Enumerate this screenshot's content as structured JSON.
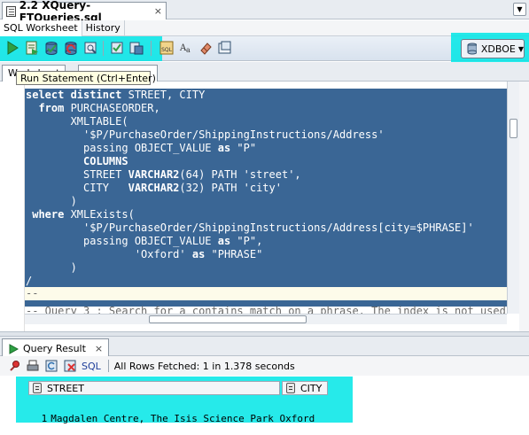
{
  "document_tab": {
    "title": "2.2 XQuery-FTQueries.sql",
    "close_glyph": "×",
    "menu_glyph": "▼"
  },
  "sub_tabs": [
    "SQL Worksheet",
    "History"
  ],
  "toolbar": {
    "icons": [
      "run-statement-icon",
      "run-script-icon",
      "commit-icon",
      "rollback-icon",
      "autotrace-icon",
      "explain-plan-icon",
      "sql-tuning-icon",
      "clear-icon",
      "sql-history-icon",
      "format-case-icon",
      "eraser-icon",
      "find-icon"
    ],
    "connection": "XDBOE",
    "highlight_color": "#00e6e6"
  },
  "tooltip": {
    "text": "Run Statement (Ctrl+Enter)"
  },
  "worksheet_tab_label": "Worksheet",
  "editor": {
    "lines": [
      [
        "select distinct",
        " STREET, CITY"
      ],
      [
        "  from",
        " PURCHASEORDER,"
      ],
      [
        "",
        "       XMLTABLE("
      ],
      [
        "",
        "         '$P/PurchaseOrder/ShippingInstructions/Address'"
      ],
      [
        "",
        "         passing OBJECT_VALUE ",
        "as",
        " \"P\""
      ],
      [
        "",
        "         ",
        "COLUMNS"
      ],
      [
        "",
        "         STREET ",
        "VARCHAR2",
        "(64) PATH 'street',"
      ],
      [
        "",
        "         CITY   ",
        "VARCHAR2",
        "(32) PATH 'city'"
      ],
      [
        "",
        "       )"
      ],
      [
        " where",
        " XMLExists("
      ],
      [
        "",
        "         '$P/PurchaseOrder/ShippingInstructions/Address[city=$PHRASE]'"
      ],
      [
        "",
        "         passing OBJECT_VALUE ",
        "as",
        " \"P\","
      ],
      [
        "",
        "                 'Oxford' ",
        "as",
        " \"PHRASE\""
      ],
      [
        "",
        "       )"
      ],
      [
        "",
        "/"
      ]
    ],
    "caret_line": "--",
    "comment_line": "-- Query 3 : Search for a contains match on a phrase. The index is not used",
    "selection_color": "#3a6695"
  },
  "query_result": {
    "tab_label": "Query Result",
    "close_glyph": "×",
    "sql_link": "SQL",
    "status": "All Rows Fetched: 1 in 1.378 seconds",
    "columns": [
      "STREET",
      "CITY"
    ],
    "rows": [
      {
        "num": "1",
        "street": "Magdalen Centre, The Isis Science Park",
        "city": "Oxford"
      }
    ]
  }
}
